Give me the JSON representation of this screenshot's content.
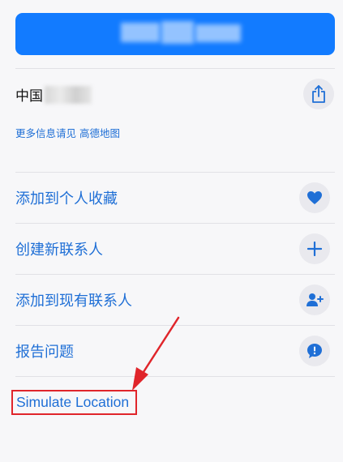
{
  "top_button": {
    "blurred_text": ""
  },
  "place": {
    "address_prefix": "中国",
    "more_info_prefix": "更多信息请见",
    "more_info_link": "高德地图"
  },
  "actions": [
    {
      "label": "添加到个人收藏",
      "icon": "heart-icon"
    },
    {
      "label": "创建新联系人",
      "icon": "plus-icon"
    },
    {
      "label": "添加到现有联系人",
      "icon": "person-add-icon"
    },
    {
      "label": "报告问题",
      "icon": "exclamation-bubble-icon"
    }
  ],
  "simulate_location": {
    "label": "Simulate Location"
  },
  "colors": {
    "accent": "#127bff",
    "link": "#1f6fd6",
    "highlight": "#e0252b"
  }
}
